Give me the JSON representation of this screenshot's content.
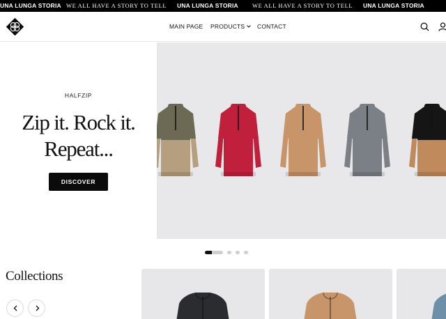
{
  "ticker": {
    "items": [
      {
        "text": "UNA LUNGA STORIA",
        "style": "sans"
      },
      {
        "text": "WE ALL HAVE A STORY TO TELL",
        "style": "serif"
      },
      {
        "text": "UNA LUNGA STORIA",
        "style": "sans"
      },
      {
        "text": "WE ALL HAVE A STORY TO TELL",
        "style": "serif"
      },
      {
        "text": "UNA LUNGA STORIA",
        "style": "sans"
      }
    ]
  },
  "header": {
    "logo_icon": "diamond-knot-logo-icon",
    "nav": {
      "main_page": "MAIN PAGE",
      "products": "PRODUCTS",
      "contact": "CONTACT"
    },
    "icons": [
      "search-icon",
      "user-icon"
    ]
  },
  "hero": {
    "eyebrow": "HALFZIP",
    "headline_line1": "Zip it. Rock it.",
    "headline_line2": "Repeat...",
    "cta_label": "DISCOVER",
    "jackets": [
      {
        "name": "olive-tan-halfzip",
        "top": "#6c6a55",
        "bottom": "#b59f7e"
      },
      {
        "name": "red-halfzip",
        "top": "#c0203c",
        "bottom": "#c0203c"
      },
      {
        "name": "camel-halfzip",
        "top": "#c8956a",
        "bottom": "#c8956a"
      },
      {
        "name": "grey-halfzip",
        "top": "#7b7f86",
        "bottom": "#7b7f86"
      },
      {
        "name": "black-tan-halfzip",
        "top": "#151515",
        "bottom": "#c08a5c"
      }
    ]
  },
  "slider": {
    "total_slides": 4,
    "active_index": 0
  },
  "collections": {
    "title": "Collections",
    "cards": [
      {
        "name": "black-hoodie",
        "color": "#2a2c30"
      },
      {
        "name": "camel-hoodie",
        "color": "#c8956a"
      },
      {
        "name": "blue-hoodie",
        "color": "#6e8fa8"
      }
    ]
  },
  "colors": {
    "ticker_bg": "#000000",
    "hero_bg": "#e8e8ea",
    "cta_bg": "#0b0b0b"
  }
}
